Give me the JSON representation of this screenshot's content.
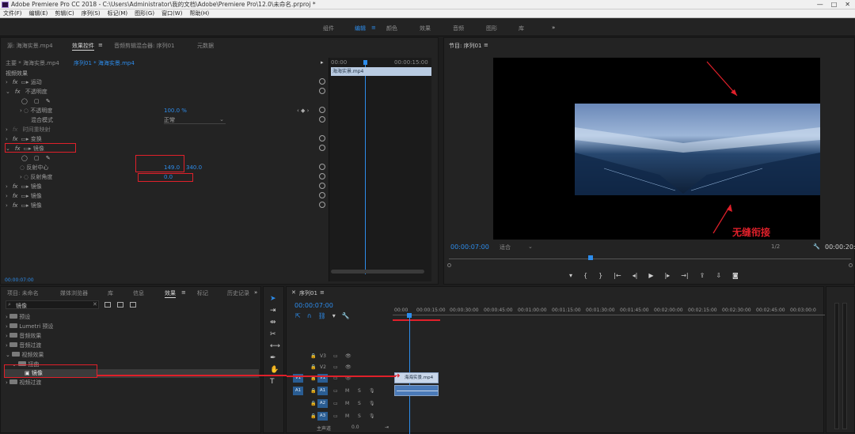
{
  "window": {
    "title": "Adobe Premiere Pro CC 2018 - C:\\Users\\Administrator\\我的文档\\Adobe\\Premiere Pro\\12.0\\未命名.prproj *"
  },
  "menu": [
    "文件(F)",
    "编辑(E)",
    "剪辑(C)",
    "序列(S)",
    "标记(M)",
    "图形(G)",
    "窗口(W)",
    "帮助(H)"
  ],
  "workspaces": [
    "组件",
    "编辑",
    "颜色",
    "效果",
    "音频",
    "图形",
    "库",
    "»"
  ],
  "effect_controls": {
    "tabs": [
      "源: 海海实景.mp4",
      "效果控件",
      "音频剪辑混合器: 序列01",
      "元数据"
    ],
    "master_clip": "主要 * 海海实景.mp4",
    "clip_ref": "序列01 * 海海实景.mp4",
    "video_effects_label": "视频效果",
    "effects": [
      {
        "name": "运动"
      },
      {
        "name": "不透明度"
      },
      {
        "name": "时间重映射"
      },
      {
        "name": "变换"
      },
      {
        "name": "镜像"
      },
      {
        "name": "镜像"
      },
      {
        "name": "镜像"
      },
      {
        "name": "镜像"
      }
    ],
    "opacity_label": "不透明度",
    "opacity_value": "100.0 %",
    "blend_label": "混合模式",
    "blend_value": "正常",
    "reflection_center_label": "反射中心",
    "reflection_center_x": "149.0",
    "reflection_center_y": "340.0",
    "reflection_angle_label": "反射角度",
    "reflection_angle_value": "0.0",
    "mini_timeline_start": "00:00",
    "mini_timeline_end": "00:00:15:00",
    "mini_clip": "海海实景.mp4",
    "timecode": "00:00:07:00"
  },
  "program_monitor": {
    "title": "节目: 序列01",
    "timecode": "00:00:07:00",
    "fit": "适合",
    "quality": "1/2",
    "duration": "00:00:20:",
    "annotation": "无缝衔接"
  },
  "project_panel": {
    "tabs": [
      "项目: 未命名",
      "媒体浏览器",
      "库",
      "信息",
      "效果",
      "标记",
      "历史记录"
    ],
    "search": "镜像",
    "tree": [
      {
        "label": "预设",
        "level": 0
      },
      {
        "label": "Lumetri 预设",
        "level": 0
      },
      {
        "label": "音频效果",
        "level": 0
      },
      {
        "label": "音频过渡",
        "level": 0
      },
      {
        "label": "视频效果",
        "level": 0
      },
      {
        "label": "扭曲",
        "level": 1
      },
      {
        "label": "镜像",
        "level": 2
      },
      {
        "label": "视频过渡",
        "level": 0
      }
    ]
  },
  "timeline": {
    "title": "序列01",
    "timecode": "00:00:07:00",
    "ruler": [
      "00:00",
      "00:00:15:00",
      "00:00:30:00",
      "00:00:45:00",
      "00:01:00:00",
      "00:01:15:00",
      "00:01:30:00",
      "00:01:45:00",
      "00:02:00:00",
      "00:02:15:00",
      "00:02:30:00",
      "00:02:45:00",
      "00:03:00:0"
    ],
    "video_tracks": [
      "V3",
      "V2",
      "V1"
    ],
    "audio_tracks": [
      "A1",
      "A2",
      "A3"
    ],
    "source_v": "V1",
    "source_a": "A1",
    "master_label": "主声道",
    "master_value": "0.0",
    "clip_label": "海海实景.mp4"
  },
  "accent": "#2d8ceb",
  "highlight": "#e0202a"
}
